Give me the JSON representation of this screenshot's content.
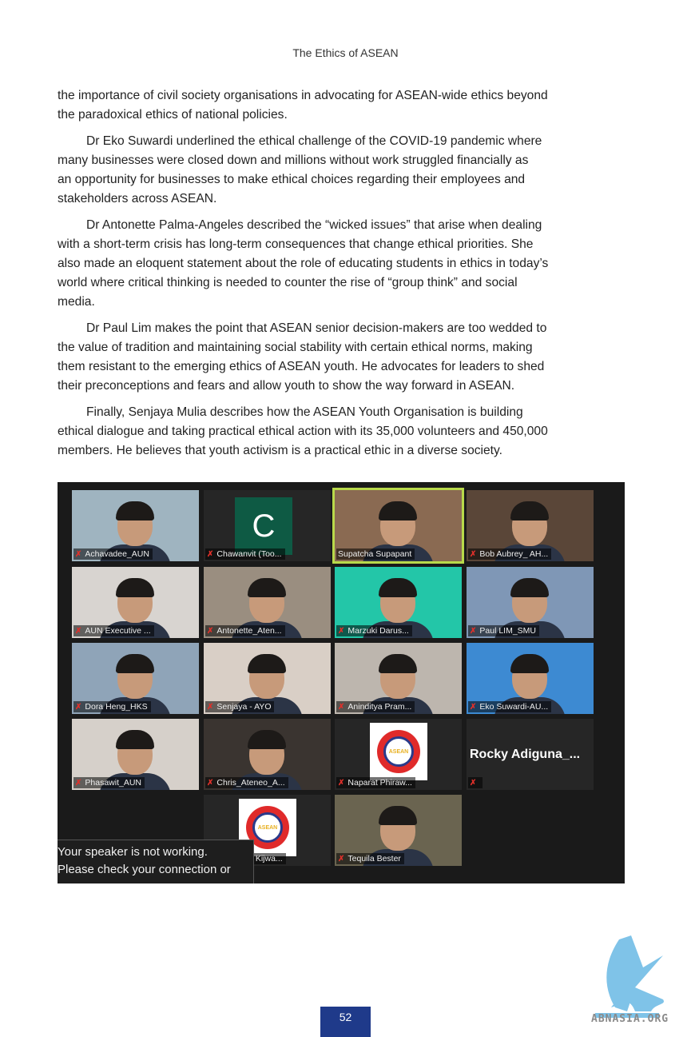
{
  "header": {
    "title": "The Ethics of ASEAN"
  },
  "paragraphs": [
    {
      "indent": false,
      "lines": [
        "the  importance of civil society organisations in advocating for ASEAN-wide ethics beyond",
        "the paradoxical ethics of national policies."
      ]
    },
    {
      "indent": true,
      "lines": [
        "Dr Eko Suwardi underlined the ethical challenge of the COVID-19 pandemic where",
        "many businesses were closed down and millions without work struggled financially as",
        "an opportunity for businesses to make ethical choices regarding their employees and",
        "stakeholders across ASEAN."
      ]
    },
    {
      "indent": true,
      "lines": [
        "Dr Antonette Palma-Angeles described the “wicked issues” that arise when dealing",
        "with a short-term crisis has long-term consequences that change ethical priorities. She",
        "also made an eloquent statement about the role of educating students in ethics in today’s",
        "world where critical thinking is needed to counter the rise of “group think” and social",
        "media."
      ]
    },
    {
      "indent": true,
      "lines": [
        "Dr Paul Lim makes the point that ASEAN senior decision-makers are too wedded to",
        "the value of tradition and maintaining social stability with certain ethical norms, making",
        "them resistant to the emerging ethics of ASEAN youth. He advocates for leaders to shed",
        "their preconceptions and fears and allow youth to show the way forward in ASEAN."
      ]
    },
    {
      "indent": true,
      "lines": [
        "Finally, Senjaya Mulia describes how the ASEAN Youth Organisation is building",
        "ethical dialogue and taking practical ethical action with its 35,000 volunteers and 450,000",
        "members. He believes that youth activism is a practical ethic in a diverse society."
      ]
    }
  ],
  "zoom": {
    "participants": [
      {
        "name": "Achavadee_AUN",
        "muted": true,
        "kind": "video",
        "bg": "#9fb4c0"
      },
      {
        "name": "Chawanvit (Too...",
        "muted": true,
        "kind": "letter",
        "letter": "C"
      },
      {
        "name": "Supatcha Supapant",
        "muted": false,
        "kind": "video",
        "bg": "#8a6a52",
        "active": true
      },
      {
        "name": "Bob Aubrey_ AH...",
        "muted": true,
        "kind": "video",
        "bg": "#5a4638"
      },
      {
        "name": "AUN Executive ...",
        "muted": true,
        "kind": "video",
        "bg": "#d8d4d0"
      },
      {
        "name": "Antonette_Aten...",
        "muted": true,
        "kind": "video",
        "bg": "#9a8e80"
      },
      {
        "name": "Marzuki Darus...",
        "muted": true,
        "kind": "video",
        "bg": "#23c6a8"
      },
      {
        "name": "Paul LIM_SMU",
        "muted": true,
        "kind": "video",
        "bg": "#7f97b6"
      },
      {
        "name": "Dora Heng_HKS",
        "muted": true,
        "kind": "video",
        "bg": "#8fa4b8"
      },
      {
        "name": "Senjaya - AYO",
        "muted": true,
        "kind": "video",
        "bg": "#d9cfc6"
      },
      {
        "name": "Aninditya Pram...",
        "muted": true,
        "kind": "video",
        "bg": "#bdb6ae"
      },
      {
        "name": "Eko Suwardi-AU...",
        "muted": true,
        "kind": "video",
        "bg": "#3d8ad2"
      },
      {
        "name": "Phasawit_AUN",
        "muted": true,
        "kind": "video",
        "bg": "#d6d0ca"
      },
      {
        "name": "Chris_Ateneo_A...",
        "muted": true,
        "kind": "video",
        "bg": "#3a3430"
      },
      {
        "name": "Naparat Phiraw...",
        "muted": true,
        "kind": "logo"
      },
      {
        "name": "Rocky  Adiguna_...",
        "muted": true,
        "kind": "text"
      },
      {
        "name": "Buranond Kijwa...",
        "muted": true,
        "kind": "logo"
      },
      {
        "name": "Tequila Bester",
        "muted": true,
        "kind": "video",
        "bg": "#6a6450"
      }
    ],
    "logo_emblem": "ASEAN",
    "toast": [
      "Your speaker is not working.",
      "Please check your connection or"
    ]
  },
  "footer": {
    "page_number": "52",
    "watermark": "ABNASIA.ORG",
    "watermark_color": "#7fc3e8"
  }
}
